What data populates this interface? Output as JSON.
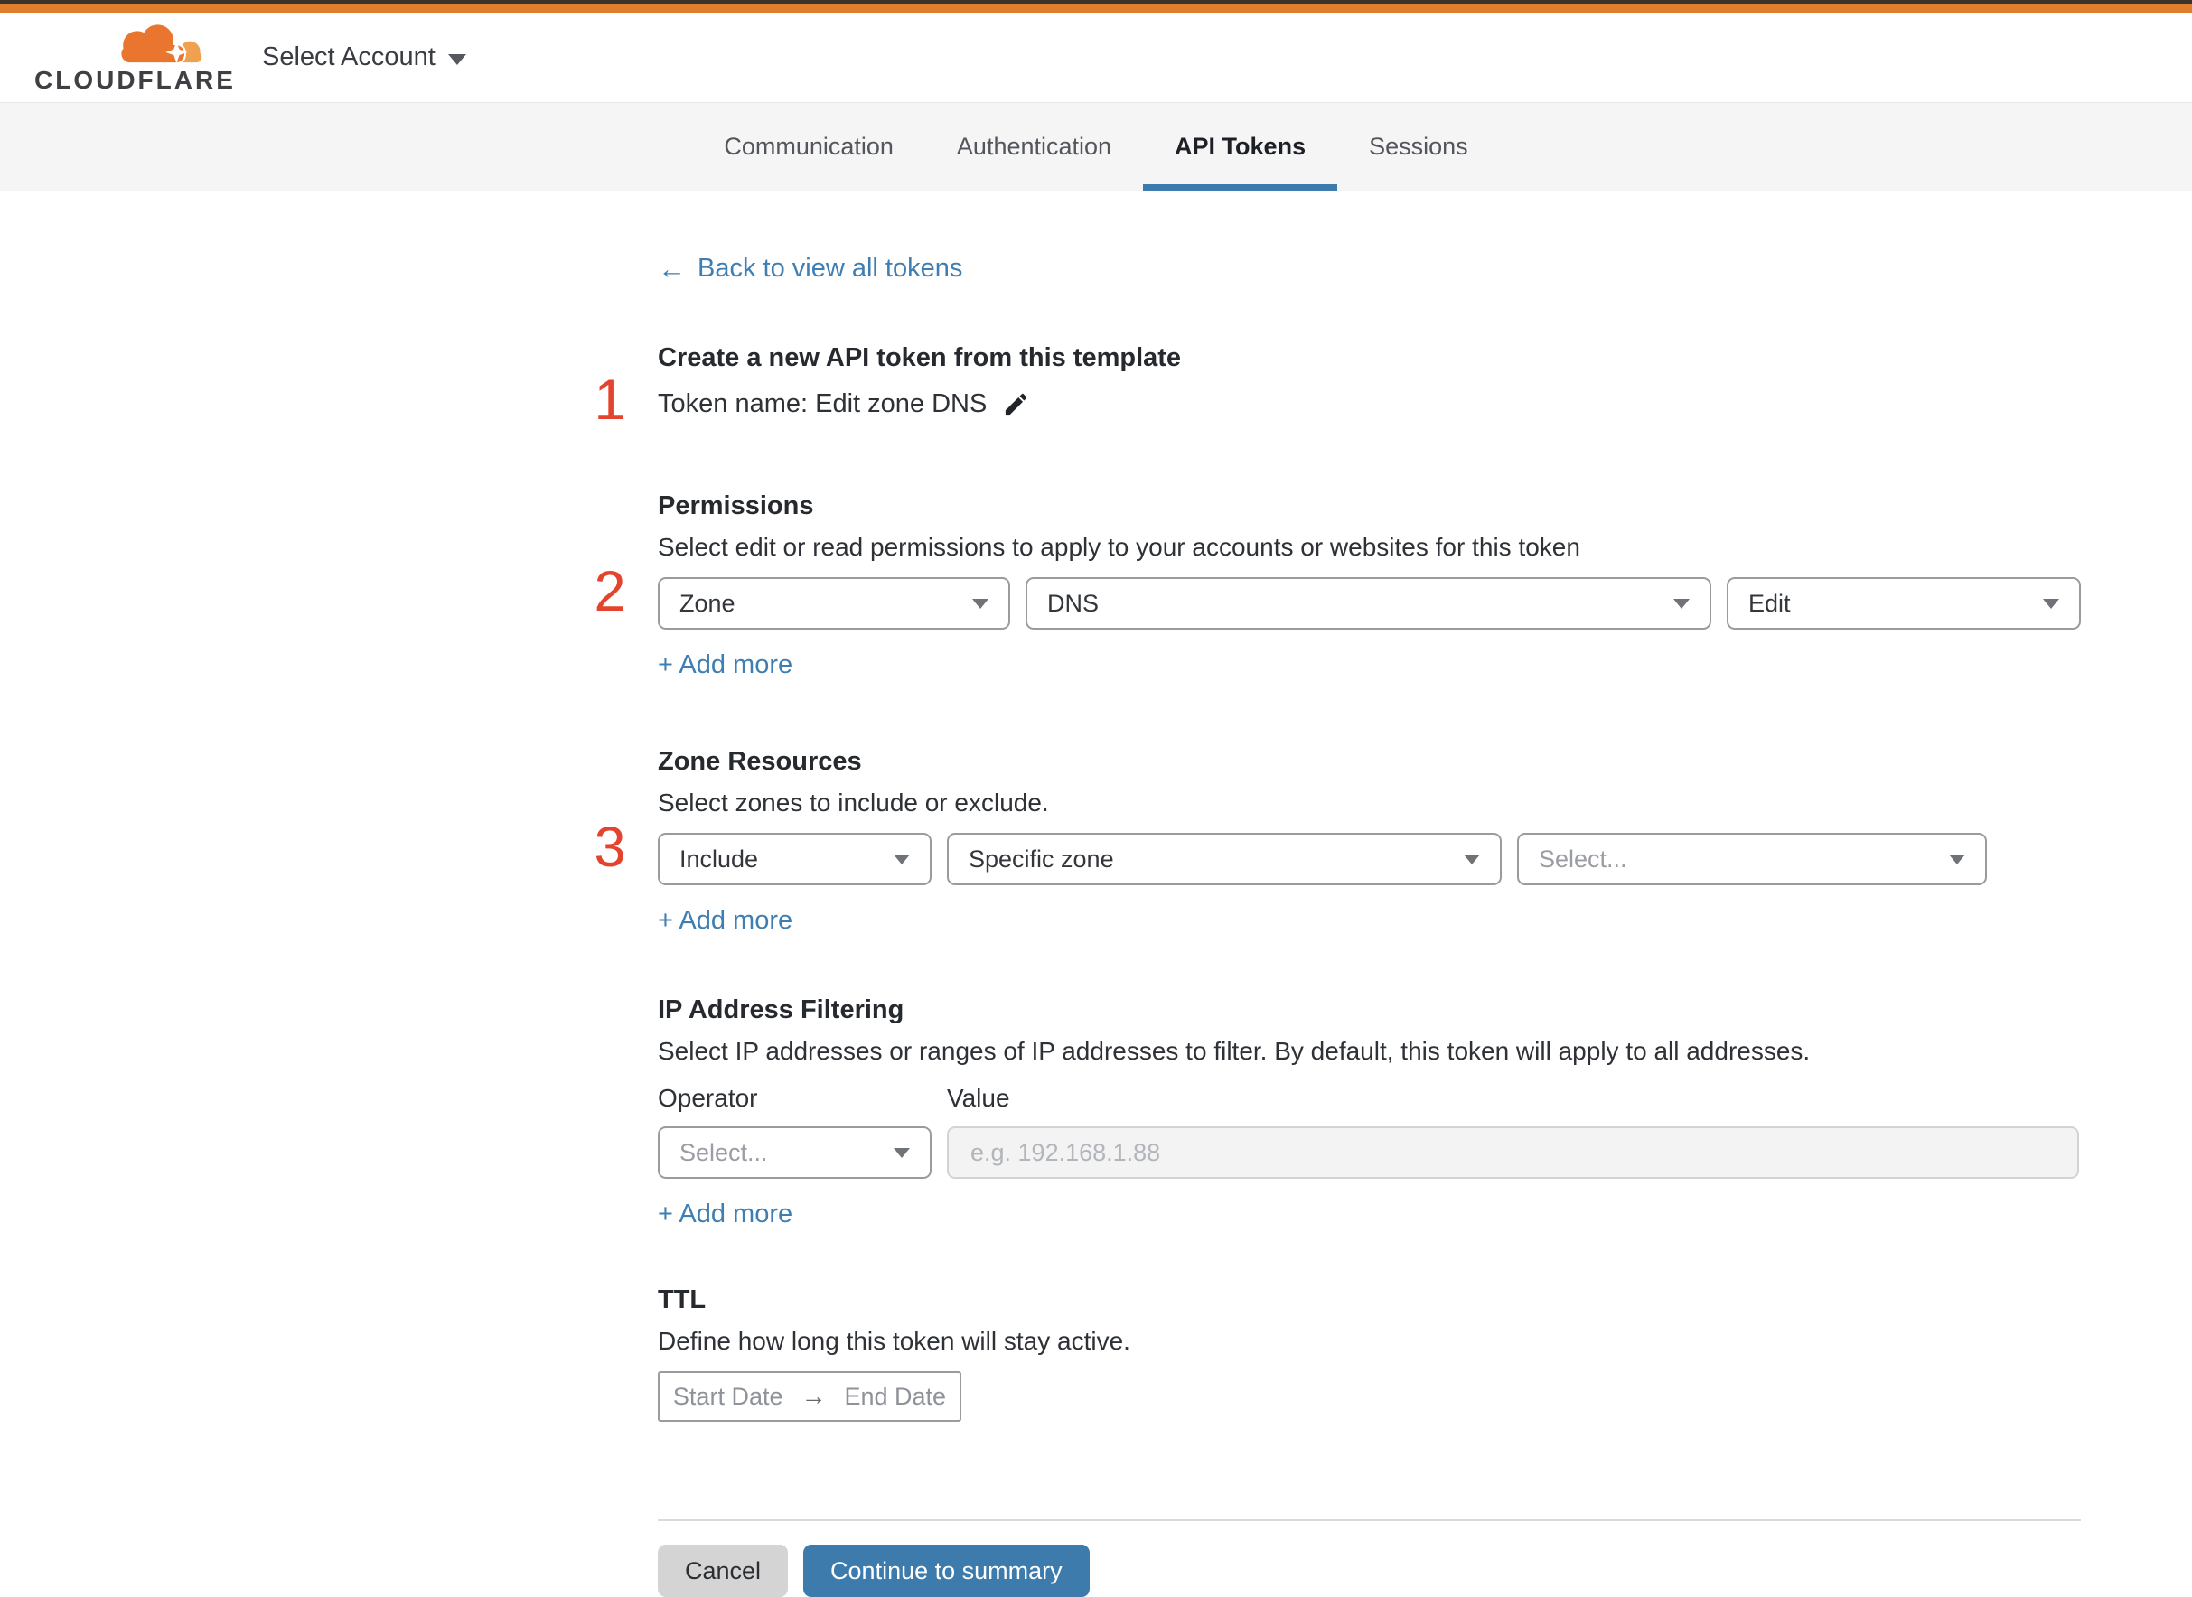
{
  "colors": {
    "brand_orange": "#e17e2d",
    "link_blue": "#3f7eb3",
    "button_blue": "#3c7bab",
    "step_red": "#e4432d"
  },
  "header": {
    "brand_wordmark": "CLOUDFLARE",
    "account_selector_label": "Select Account"
  },
  "tabs": [
    {
      "label": "Communication",
      "active": false
    },
    {
      "label": "Authentication",
      "active": false
    },
    {
      "label": "API Tokens",
      "active": true
    },
    {
      "label": "Sessions",
      "active": false
    }
  ],
  "back_link": {
    "arrow": "←",
    "label": "Back to view all tokens"
  },
  "token_template": {
    "step_number": "1",
    "heading": "Create a new API token from this template",
    "token_name_line": "Token name: Edit zone DNS"
  },
  "permissions": {
    "step_number": "2",
    "title": "Permissions",
    "subtitle": "Select edit or read permissions to apply to your accounts or websites for this token",
    "scope_value": "Zone",
    "service_value": "DNS",
    "access_value": "Edit",
    "add_more_label": "+ Add more"
  },
  "zone_resources": {
    "step_number": "3",
    "title": "Zone Resources",
    "subtitle": "Select zones to include or exclude.",
    "mode_value": "Include",
    "type_value": "Specific zone",
    "zone_placeholder": "Select...",
    "add_more_label": "+ Add more"
  },
  "ip_filtering": {
    "title": "IP Address Filtering",
    "subtitle": "Select IP addresses or ranges of IP addresses to filter. By default, this token will apply to all addresses.",
    "operator_label": "Operator",
    "value_label": "Value",
    "operator_placeholder": "Select...",
    "value_placeholder": "e.g. 192.168.1.88",
    "add_more_label": "+ Add more"
  },
  "ttl": {
    "title": "TTL",
    "subtitle": "Define how long this token will stay active.",
    "start_date_placeholder": "Start Date",
    "range_arrow": "→",
    "end_date_placeholder": "End Date"
  },
  "footer": {
    "cancel_label": "Cancel",
    "continue_label": "Continue to summary"
  }
}
